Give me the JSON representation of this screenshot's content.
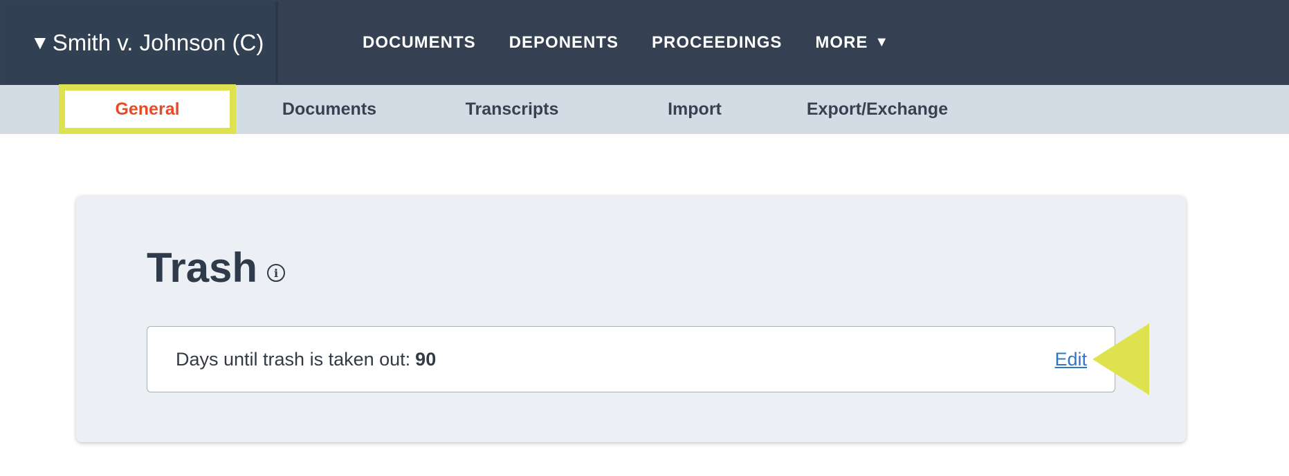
{
  "topbar": {
    "case_caret": "▼",
    "case_name": "Smith v. Johnson (C)",
    "nav": [
      {
        "label": "DOCUMENTS"
      },
      {
        "label": "DEPONENTS"
      },
      {
        "label": "PROCEEDINGS"
      },
      {
        "label": "MORE",
        "caret": "▼"
      }
    ]
  },
  "subnav": {
    "tabs": [
      {
        "label": "General",
        "active": true
      },
      {
        "label": "Documents"
      },
      {
        "label": "Transcripts"
      },
      {
        "label": "Import"
      },
      {
        "label": "Export/Exchange"
      }
    ]
  },
  "trash": {
    "title": "Trash",
    "info_icon": "info-icon",
    "days_label": "Days until trash is taken out:",
    "days_value": "90",
    "edit_label": "Edit"
  },
  "colors": {
    "topbar_bg": "#354152",
    "subnav_bg": "#d3dbe4",
    "active_tab_text": "#e84a27",
    "highlight": "#dfe24f",
    "link": "#2f76c7",
    "card_bg": "#ecf0f4"
  }
}
